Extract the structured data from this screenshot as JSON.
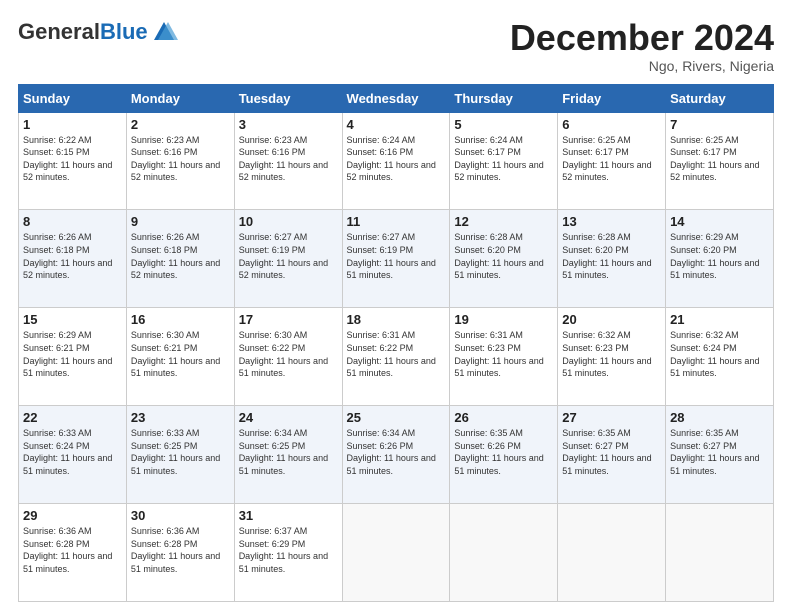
{
  "logo": {
    "general": "General",
    "blue": "Blue"
  },
  "header": {
    "month_title": "December 2024",
    "location": "Ngo, Rivers, Nigeria"
  },
  "weekdays": [
    "Sunday",
    "Monday",
    "Tuesday",
    "Wednesday",
    "Thursday",
    "Friday",
    "Saturday"
  ],
  "weeks": [
    [
      {
        "day": "1",
        "sunrise": "6:22 AM",
        "sunset": "6:15 PM",
        "daylight": "11 hours and 52 minutes."
      },
      {
        "day": "2",
        "sunrise": "6:23 AM",
        "sunset": "6:16 PM",
        "daylight": "11 hours and 52 minutes."
      },
      {
        "day": "3",
        "sunrise": "6:23 AM",
        "sunset": "6:16 PM",
        "daylight": "11 hours and 52 minutes."
      },
      {
        "day": "4",
        "sunrise": "6:24 AM",
        "sunset": "6:16 PM",
        "daylight": "11 hours and 52 minutes."
      },
      {
        "day": "5",
        "sunrise": "6:24 AM",
        "sunset": "6:17 PM",
        "daylight": "11 hours and 52 minutes."
      },
      {
        "day": "6",
        "sunrise": "6:25 AM",
        "sunset": "6:17 PM",
        "daylight": "11 hours and 52 minutes."
      },
      {
        "day": "7",
        "sunrise": "6:25 AM",
        "sunset": "6:17 PM",
        "daylight": "11 hours and 52 minutes."
      }
    ],
    [
      {
        "day": "8",
        "sunrise": "6:26 AM",
        "sunset": "6:18 PM",
        "daylight": "11 hours and 52 minutes."
      },
      {
        "day": "9",
        "sunrise": "6:26 AM",
        "sunset": "6:18 PM",
        "daylight": "11 hours and 52 minutes."
      },
      {
        "day": "10",
        "sunrise": "6:27 AM",
        "sunset": "6:19 PM",
        "daylight": "11 hours and 52 minutes."
      },
      {
        "day": "11",
        "sunrise": "6:27 AM",
        "sunset": "6:19 PM",
        "daylight": "11 hours and 51 minutes."
      },
      {
        "day": "12",
        "sunrise": "6:28 AM",
        "sunset": "6:20 PM",
        "daylight": "11 hours and 51 minutes."
      },
      {
        "day": "13",
        "sunrise": "6:28 AM",
        "sunset": "6:20 PM",
        "daylight": "11 hours and 51 minutes."
      },
      {
        "day": "14",
        "sunrise": "6:29 AM",
        "sunset": "6:20 PM",
        "daylight": "11 hours and 51 minutes."
      }
    ],
    [
      {
        "day": "15",
        "sunrise": "6:29 AM",
        "sunset": "6:21 PM",
        "daylight": "11 hours and 51 minutes."
      },
      {
        "day": "16",
        "sunrise": "6:30 AM",
        "sunset": "6:21 PM",
        "daylight": "11 hours and 51 minutes."
      },
      {
        "day": "17",
        "sunrise": "6:30 AM",
        "sunset": "6:22 PM",
        "daylight": "11 hours and 51 minutes."
      },
      {
        "day": "18",
        "sunrise": "6:31 AM",
        "sunset": "6:22 PM",
        "daylight": "11 hours and 51 minutes."
      },
      {
        "day": "19",
        "sunrise": "6:31 AM",
        "sunset": "6:23 PM",
        "daylight": "11 hours and 51 minutes."
      },
      {
        "day": "20",
        "sunrise": "6:32 AM",
        "sunset": "6:23 PM",
        "daylight": "11 hours and 51 minutes."
      },
      {
        "day": "21",
        "sunrise": "6:32 AM",
        "sunset": "6:24 PM",
        "daylight": "11 hours and 51 minutes."
      }
    ],
    [
      {
        "day": "22",
        "sunrise": "6:33 AM",
        "sunset": "6:24 PM",
        "daylight": "11 hours and 51 minutes."
      },
      {
        "day": "23",
        "sunrise": "6:33 AM",
        "sunset": "6:25 PM",
        "daylight": "11 hours and 51 minutes."
      },
      {
        "day": "24",
        "sunrise": "6:34 AM",
        "sunset": "6:25 PM",
        "daylight": "11 hours and 51 minutes."
      },
      {
        "day": "25",
        "sunrise": "6:34 AM",
        "sunset": "6:26 PM",
        "daylight": "11 hours and 51 minutes."
      },
      {
        "day": "26",
        "sunrise": "6:35 AM",
        "sunset": "6:26 PM",
        "daylight": "11 hours and 51 minutes."
      },
      {
        "day": "27",
        "sunrise": "6:35 AM",
        "sunset": "6:27 PM",
        "daylight": "11 hours and 51 minutes."
      },
      {
        "day": "28",
        "sunrise": "6:35 AM",
        "sunset": "6:27 PM",
        "daylight": "11 hours and 51 minutes."
      }
    ],
    [
      {
        "day": "29",
        "sunrise": "6:36 AM",
        "sunset": "6:28 PM",
        "daylight": "11 hours and 51 minutes."
      },
      {
        "day": "30",
        "sunrise": "6:36 AM",
        "sunset": "6:28 PM",
        "daylight": "11 hours and 51 minutes."
      },
      {
        "day": "31",
        "sunrise": "6:37 AM",
        "sunset": "6:29 PM",
        "daylight": "11 hours and 51 minutes."
      },
      null,
      null,
      null,
      null
    ]
  ]
}
